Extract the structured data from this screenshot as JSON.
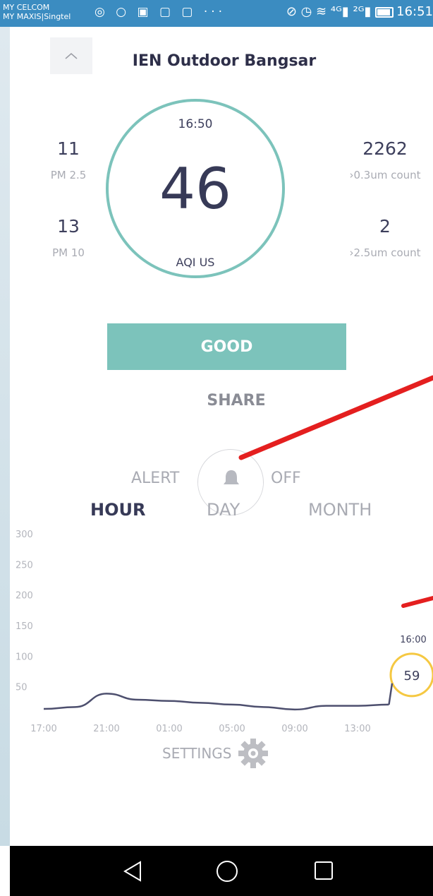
{
  "status_bar": {
    "carrier_1": "MY CELCOM",
    "carrier_2": "MY MAXIS|Singtel",
    "icons_left": "◎ ○ ▣ ▢ ▢ ···",
    "icons_right": "⊘ ◷ ≋ ⁴ᴳ▮ ²ᴳ▮",
    "time": "16:51"
  },
  "header": {
    "title": "IEN Outdoor Bangsar"
  },
  "reading": {
    "time": "16:50",
    "aqi": "46",
    "aqi_label": "AQI US",
    "pm25_value": "11",
    "pm25_label": "PM 2.5",
    "pm10_value": "13",
    "pm10_label": "PM 10",
    "count03_value": "2262",
    "count03_label": "›0.3um count",
    "count25_value": "2",
    "count25_label": "›2.5um count"
  },
  "status": {
    "label": "GOOD",
    "color": "#7cc3bb"
  },
  "share_label": "SHARE",
  "alert": {
    "label": "ALERT",
    "state": "OFF",
    "icon": "bell-icon"
  },
  "tabs": [
    {
      "label": "HOUR",
      "active": true
    },
    {
      "label": "DAY",
      "active": false
    },
    {
      "label": "MONTH",
      "active": false
    }
  ],
  "chart_data": {
    "type": "line",
    "x": [
      "17:00",
      "19:00",
      "21:00",
      "23:00",
      "01:00",
      "03:00",
      "05:00",
      "07:00",
      "09:00",
      "11:00",
      "13:00",
      "15:00",
      "16:00"
    ],
    "y": [
      15,
      18,
      40,
      30,
      28,
      25,
      22,
      18,
      14,
      20,
      20,
      22,
      59
    ],
    "xticks": [
      "17:00",
      "21:00",
      "01:00",
      "05:00",
      "09:00",
      "13:00"
    ],
    "yticks": [
      50,
      100,
      150,
      200,
      250,
      300
    ],
    "ylim": [
      0,
      300
    ],
    "line_color": "#4d4f6e",
    "highlight": {
      "label": "16:00",
      "value": "59",
      "color": "#f5c842"
    }
  },
  "settings_label": "SETTINGS",
  "nav": {
    "back": "back-icon",
    "home": "home-icon",
    "recents": "recents-icon"
  }
}
